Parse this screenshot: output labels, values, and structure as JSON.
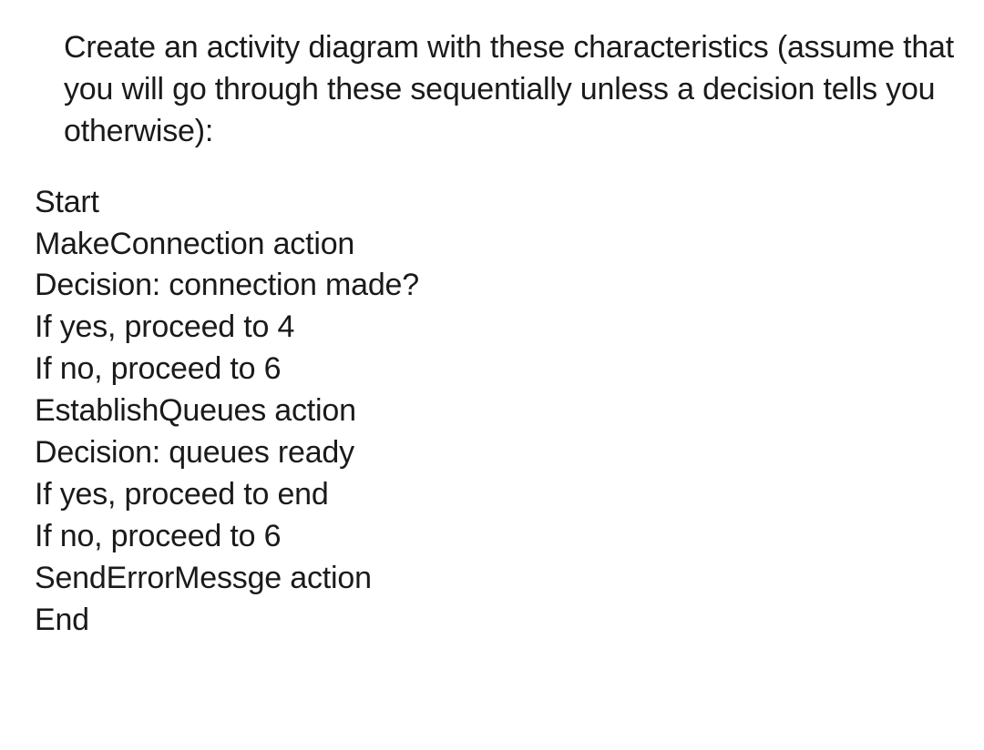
{
  "intro": "Create an activity diagram with these characteristics (assume that you will go through these sequentially unless a decision tells you otherwise):",
  "steps": [
    "Start",
    "MakeConnection action",
    "Decision: connection made?",
    "If yes, proceed to 4",
    "If no, proceed to 6",
    "EstablishQueues action",
    "Decision: queues ready",
    "If yes, proceed to end",
    "If no, proceed to 6",
    "SendErrorMessge action",
    "End"
  ]
}
